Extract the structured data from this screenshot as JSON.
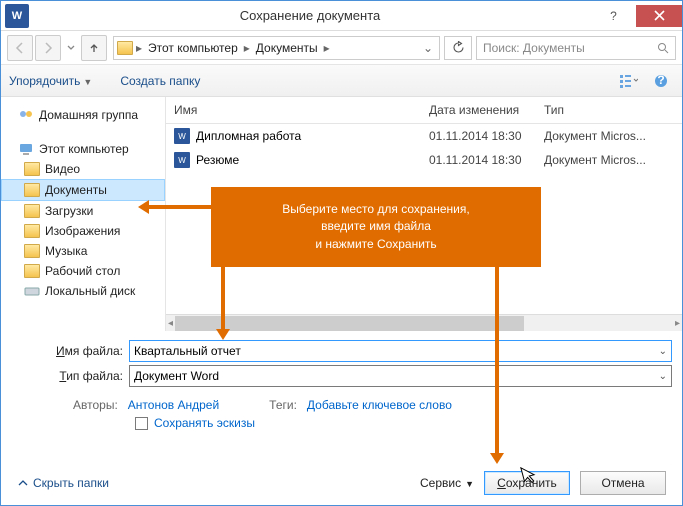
{
  "title": "Сохранение документа",
  "breadcrumb": {
    "loc1": "Этот компьютер",
    "loc2": "Документы"
  },
  "search": {
    "placeholder": "Поиск: Документы"
  },
  "toolbar": {
    "organize": "Упорядочить",
    "newfolder": "Создать папку"
  },
  "cols": {
    "name": "Имя",
    "date": "Дата изменения",
    "type": "Тип"
  },
  "sidebar": {
    "homegroup": "Домашняя группа",
    "thispc": "Этот компьютер",
    "items": [
      "Видео",
      "Документы",
      "Загрузки",
      "Изображения",
      "Музыка",
      "Рабочий стол",
      "Локальный диск"
    ]
  },
  "files": [
    {
      "name": "Дипломная работа",
      "date": "01.11.2014 18:30",
      "type": "Документ Micros..."
    },
    {
      "name": "Резюме",
      "date": "01.11.2014 18:30",
      "type": "Документ Micros..."
    }
  ],
  "form": {
    "filename_label": "Имя файла:",
    "filetype_label": "Тип файла:",
    "filename_value": "Квартальный отчет",
    "filetype_value": "Документ Word"
  },
  "meta": {
    "authors_k": "Авторы:",
    "authors_v": "Антонов Андрей",
    "tags_k": "Теги:",
    "tags_v": "Добавьте ключевое слово"
  },
  "checkbox": {
    "label": "Сохранять эскизы"
  },
  "footer": {
    "hide": "Скрыть папки",
    "tools": "Сервис",
    "save": "Сохранить",
    "cancel": "Отмена"
  },
  "callout": {
    "l1": "Выберите место для сохранения,",
    "l2": "введите имя файла",
    "l3": "и нажмите Сохранить"
  }
}
